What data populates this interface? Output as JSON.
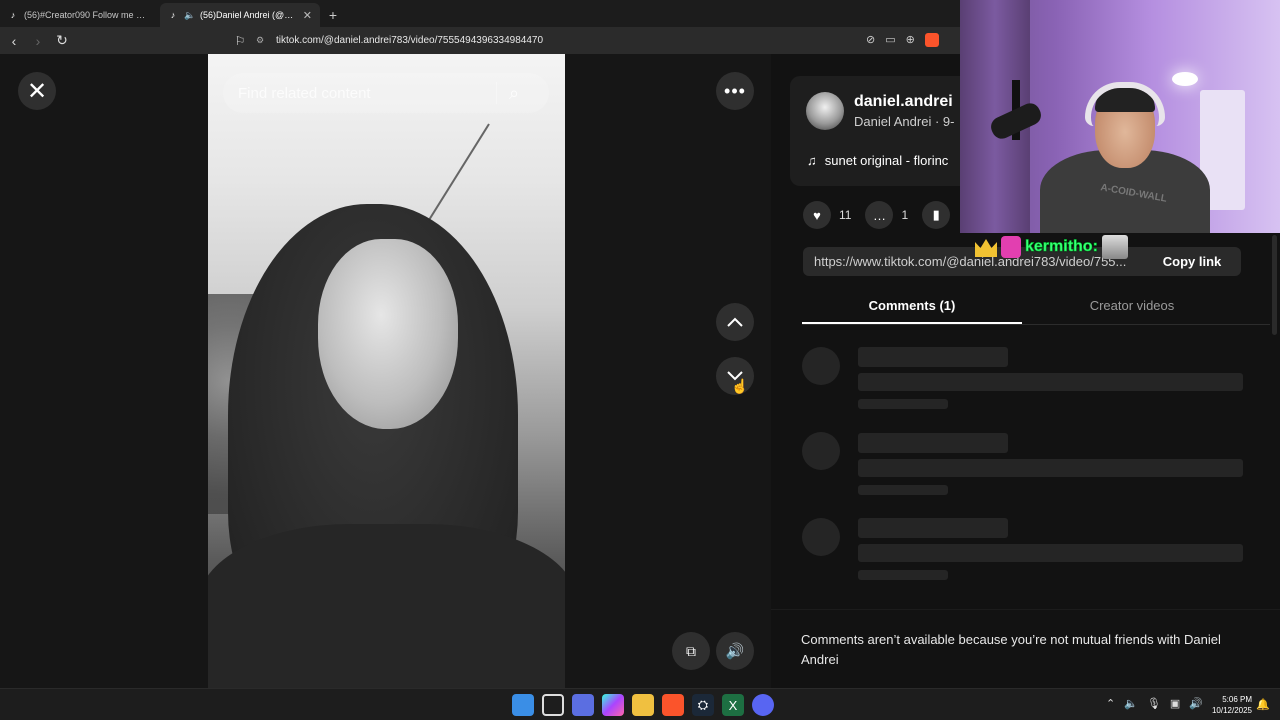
{
  "browser": {
    "tabs": [
      {
        "label": "(56)#Creator090 Follow me 🍪 /6 | T",
        "active": false
      },
      {
        "label": "(56)Daniel Andrei (@daniel.an",
        "active": true
      }
    ],
    "new_tab": "+",
    "url": "tiktok.com/@daniel.andrei783/video/7555494396334984470"
  },
  "viewer": {
    "search_placeholder": "Find related content",
    "icons": [
      "close-icon",
      "more-icon",
      "chevron-up-icon",
      "chevron-down-icon",
      "pip-icon",
      "volume-icon"
    ]
  },
  "author": {
    "username": "daniel.andrei",
    "nickname": "Daniel Andrei · 9-",
    "music": "sunet original - florinc"
  },
  "stats": {
    "likes": "11",
    "comments": "1"
  },
  "share": {
    "link": "https://www.tiktok.com/@daniel.andrei783/video/755...",
    "copy_label": "Copy link"
  },
  "panel_tabs": {
    "comments": "Comments (1)",
    "creator_videos": "Creator videos"
  },
  "notice": "Comments aren’t available because you’re not mutual friends with Daniel Andrei",
  "stream_overlay": {
    "chat_name": "kermitho:",
    "shirt_text": "A-COID-WALL"
  },
  "taskbar": {
    "time": "5:06 PM",
    "date": "10/12/2025"
  },
  "colors": {
    "chat_name": "#3dff7a",
    "crown": "#f1c232",
    "brand": "#fb542b"
  }
}
